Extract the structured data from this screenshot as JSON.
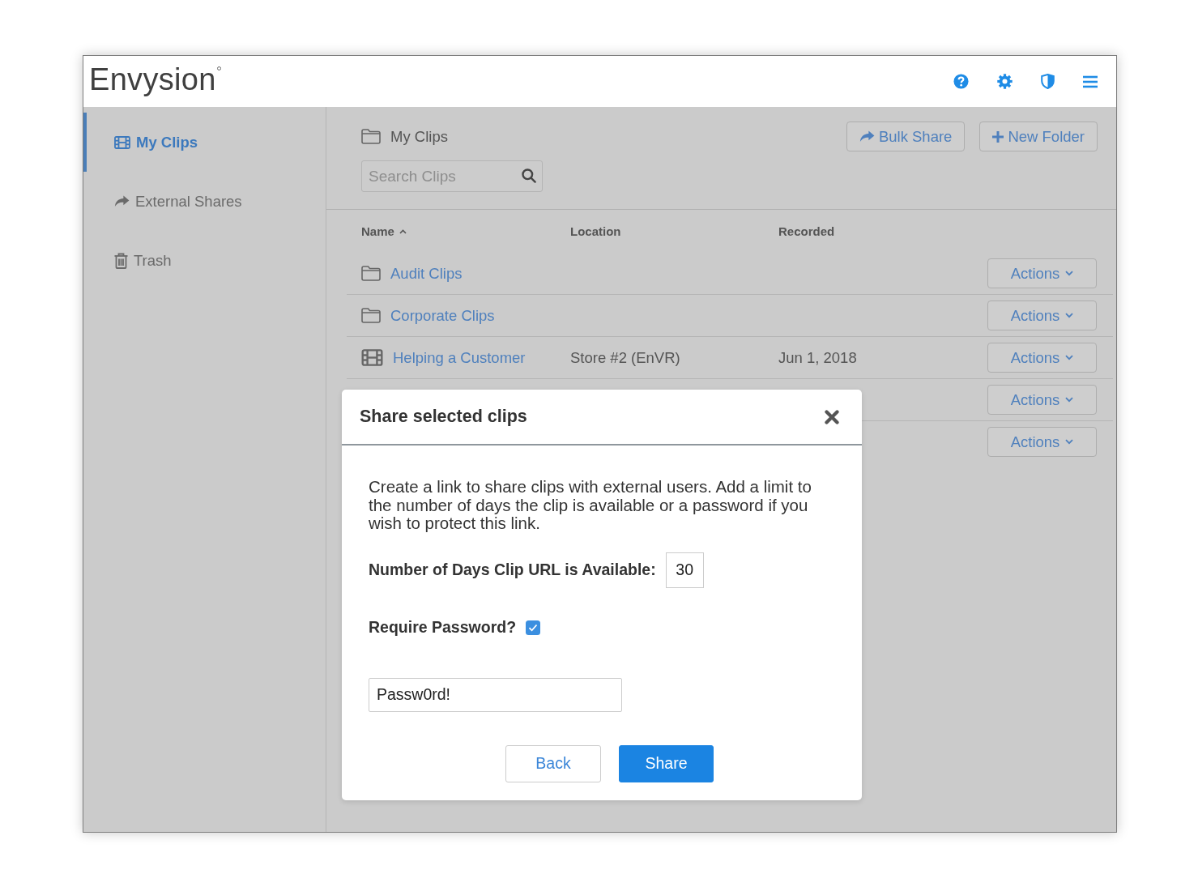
{
  "header": {
    "logo": "Envysion"
  },
  "sidebar": {
    "items": [
      {
        "label": "My Clips",
        "selected": true
      },
      {
        "label": "External Shares",
        "selected": false
      },
      {
        "label": "Trash",
        "selected": false
      }
    ]
  },
  "content": {
    "breadcrumb": "My Clips",
    "buttons": [
      "Bulk Share",
      "New Folder"
    ],
    "search": {
      "placeholder": "Search Clips"
    },
    "table": {
      "columns": [
        {
          "label": "Name",
          "sorted": true
        },
        {
          "label": "Location",
          "sorted": false
        },
        {
          "label": "Recorded",
          "sorted": false
        }
      ],
      "rows": [
        {
          "kind": "folder",
          "name": "Audit Clips",
          "actions": "Actions"
        },
        {
          "kind": "folder",
          "name": "Corporate Clips",
          "actions": "Actions"
        },
        {
          "kind": "clip",
          "name": "Helping a Customer",
          "location": "Store #2 (EnVR)",
          "recorded": "Jun 1, 2018",
          "actions": "Actions"
        },
        {
          "actions": "Actions"
        },
        {
          "actions": "Actions"
        }
      ]
    }
  },
  "modal": {
    "title": "Share selected clips",
    "description": "Create a link to share clips with external users. Add a limit to the number of days the clip is available or a password if you wish to protect this link.",
    "days": {
      "label": "Number of Days Clip URL is Available:",
      "value": "30"
    },
    "require_password": {
      "label": "Require Password?",
      "checked": true
    },
    "password": {
      "value": "Passw0rd!"
    },
    "buttons": [
      {
        "label": "Back",
        "kind": "secondary"
      },
      {
        "label": "Share",
        "kind": "primary"
      }
    ]
  }
}
